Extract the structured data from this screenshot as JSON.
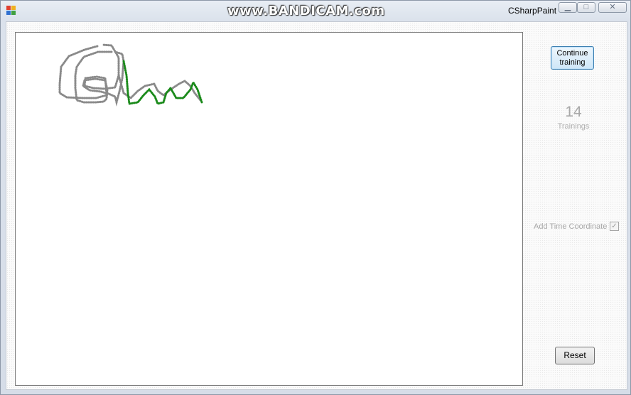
{
  "window": {
    "title": "CSharpPaint",
    "watermark": "www.BANDICAM.com",
    "minimize_icon": "minimize-icon",
    "maximize_icon": "maximize-icon",
    "close_icon": "close-icon"
  },
  "panel": {
    "continue_button_label": "Continue\ntraining",
    "training_count": "14",
    "training_label": "Trainings",
    "time_coordinate_label": "Add Time Coordinate",
    "time_coordinate_checked": true,
    "reset_button_label": "Reset"
  },
  "colors": {
    "stroke_gray": "#8a8a8a",
    "stroke_green": "#1a8a1a",
    "canvas_background": "#ffffff",
    "accent_button_border": "#3c7fb1"
  }
}
